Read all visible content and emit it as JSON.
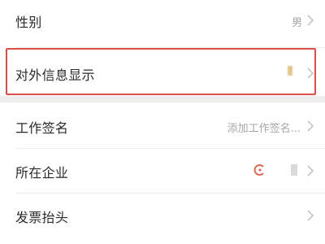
{
  "settings": {
    "gender": {
      "label": "性别",
      "value": "男"
    },
    "external_display": {
      "label": "对外信息显示"
    },
    "work_signature": {
      "label": "工作签名",
      "placeholder": "添加工作签名..."
    },
    "company": {
      "label": "所在企业"
    },
    "invoice_title": {
      "label": "发票抬头"
    }
  },
  "colors": {
    "highlight": "#d9504d",
    "page_bg": "#eeeeef",
    "chevron": "#c4c4c4"
  }
}
